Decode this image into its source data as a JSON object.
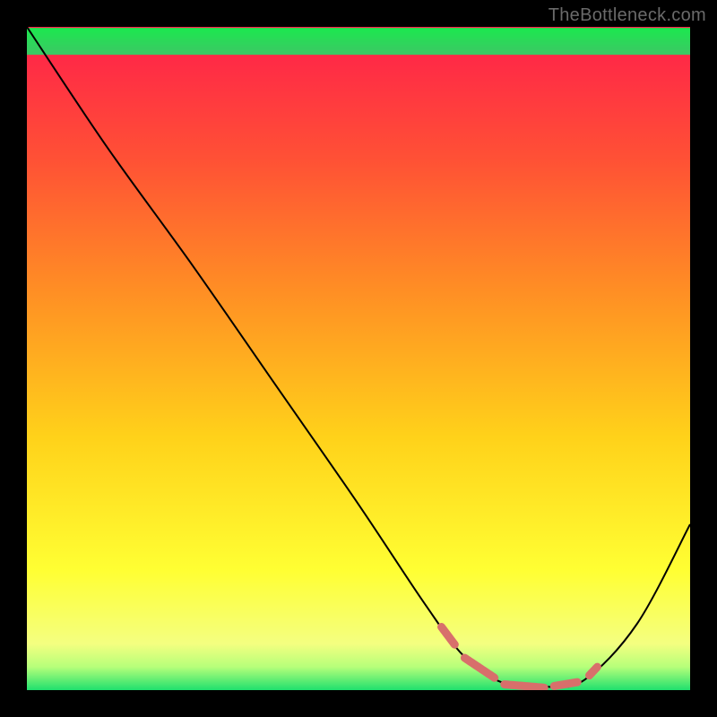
{
  "watermark": "TheBottleneck.com",
  "chart_data": {
    "type": "line",
    "title": "",
    "xlabel": "",
    "ylabel": "",
    "xlim": [
      0,
      100
    ],
    "ylim": [
      0,
      100
    ],
    "series": [
      {
        "name": "bottleneck-curve",
        "x": [
          0,
          12,
          25,
          37.5,
          50,
          60,
          66,
          72,
          78,
          84,
          92,
          100
        ],
        "values": [
          100,
          82,
          64,
          46,
          28,
          13,
          5,
          1,
          0.5,
          1.5,
          10,
          25
        ]
      }
    ],
    "optimal_markers": {
      "name": "optimal-zone",
      "color": "#d86f6b",
      "segments_x": [
        [
          62.5,
          64.5
        ],
        [
          66.0,
          70.5
        ],
        [
          72.0,
          78.0
        ],
        [
          79.5,
          83.0
        ],
        [
          84.8,
          86.0
        ]
      ]
    },
    "background_gradient": {
      "stops": [
        {
          "offset": 0.0,
          "color": "#ff1e4b"
        },
        {
          "offset": 0.2,
          "color": "#ff5135"
        },
        {
          "offset": 0.4,
          "color": "#ff8f24"
        },
        {
          "offset": 0.62,
          "color": "#ffd21a"
        },
        {
          "offset": 0.82,
          "color": "#ffff33"
        },
        {
          "offset": 0.93,
          "color": "#f4ff80"
        },
        {
          "offset": 0.965,
          "color": "#b6ff7a"
        },
        {
          "offset": 1.0,
          "color": "#1fe06e"
        }
      ]
    },
    "green_lines": {
      "count": 14,
      "y_start": 96.0,
      "y_step": 0.28
    }
  }
}
